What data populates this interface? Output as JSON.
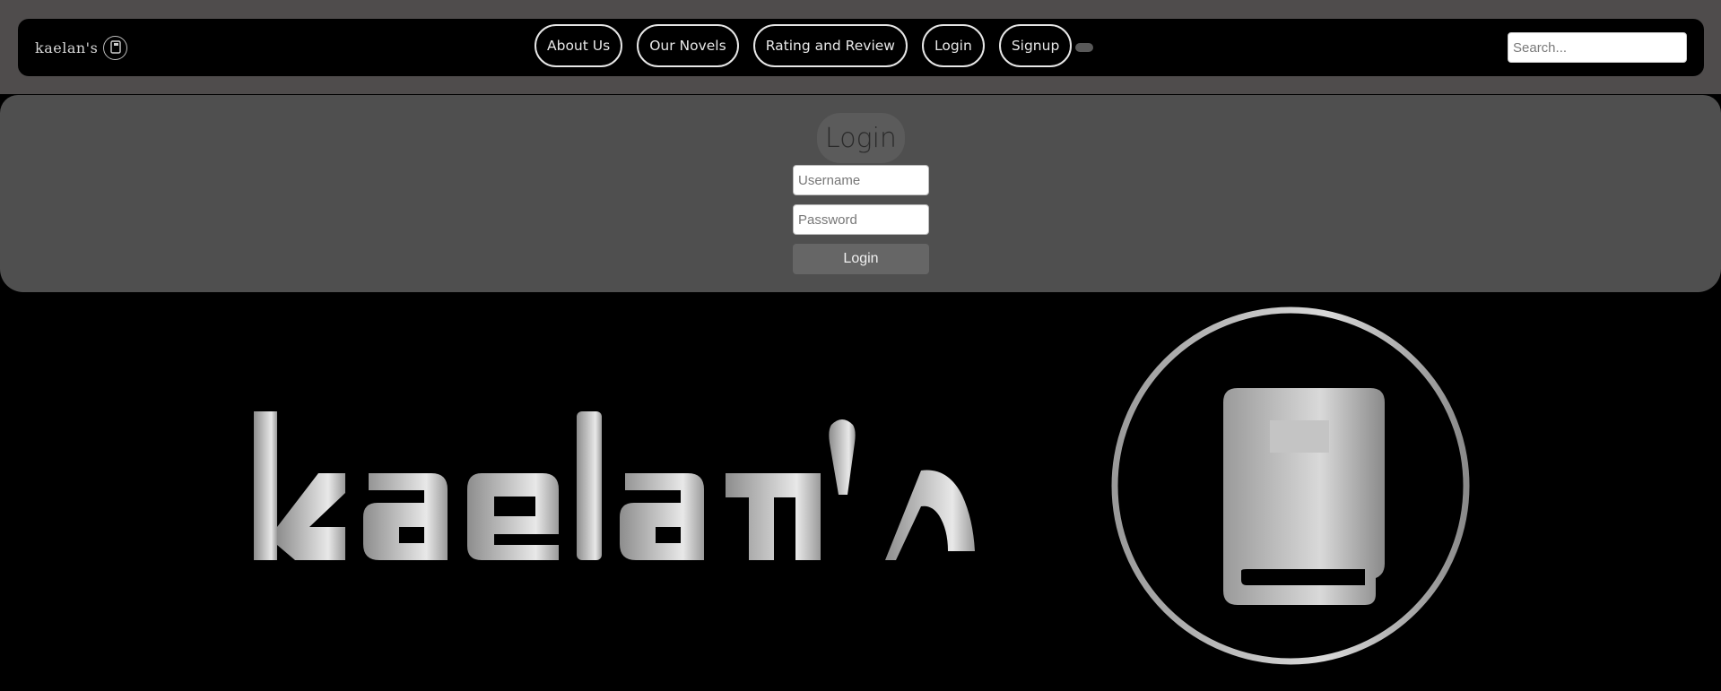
{
  "brand": {
    "name": "kaelan's",
    "icon": "book-icon"
  },
  "nav": {
    "items": [
      {
        "label": "About Us"
      },
      {
        "label": "Our Novels"
      },
      {
        "label": "Rating and Review"
      },
      {
        "label": "Login"
      },
      {
        "label": "Signup"
      }
    ]
  },
  "search": {
    "placeholder": "Search..."
  },
  "login": {
    "title": "Login",
    "username_placeholder": "Username",
    "password_placeholder": "Password",
    "submit_label": "Login"
  },
  "hero": {
    "logo_text": "kaelan's",
    "emblem_icon": "book-icon"
  },
  "colors": {
    "frame": "#4f4c4c",
    "panel": "#4f4f4f",
    "background": "#000000",
    "logo_light": "#e8e8e8",
    "logo_dark": "#8d8d8d"
  }
}
